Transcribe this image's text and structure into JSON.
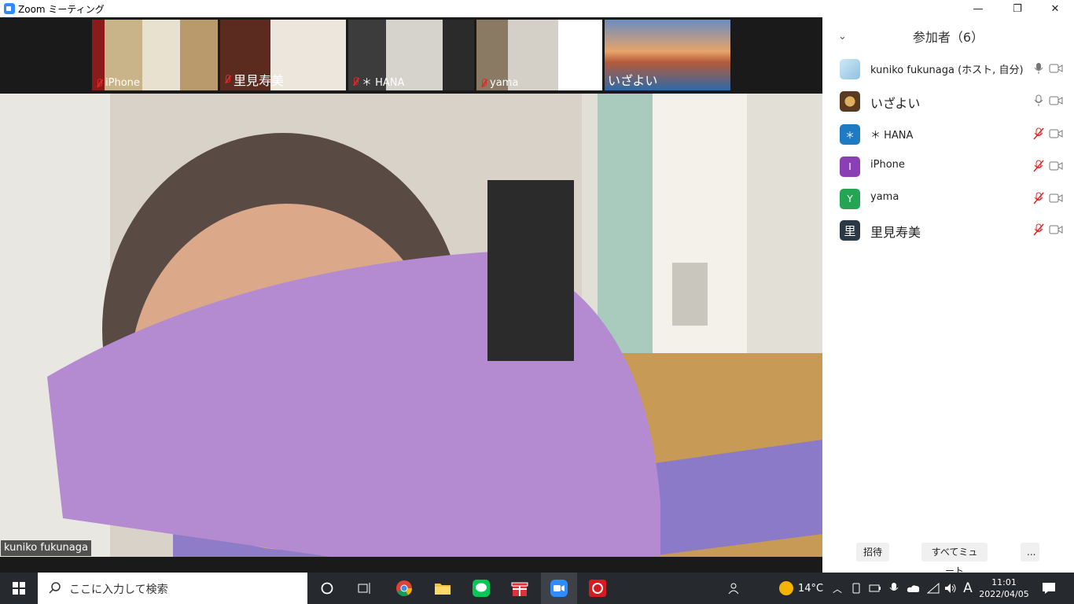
{
  "window": {
    "title": "Zoom ミーティング",
    "minimize": "—",
    "maximize": "❐",
    "close": "✕"
  },
  "thumbnails": [
    {
      "name": "iPhone",
      "muted": true
    },
    {
      "name": "里見寿美",
      "muted": true
    },
    {
      "name": "＊ HANA",
      "muted": true
    },
    {
      "name": "yama",
      "muted": true
    },
    {
      "name": "いざよい",
      "muted": false
    }
  ],
  "main_video": {
    "speaker_name": "kuniko fukunaga"
  },
  "panel": {
    "title": "参加者（6）",
    "participants": [
      {
        "name": "kuniko fukunaga (ホスト, 自分)",
        "avatar": "",
        "avatar_color": "#9ec9e8",
        "muted": false
      },
      {
        "name": "いざよい",
        "avatar": "",
        "avatar_color": "#7a5a3a",
        "muted": false
      },
      {
        "name": "＊ HANA",
        "avatar": "＊",
        "avatar_color": "#1f7ac4",
        "muted": true
      },
      {
        "name": "iPhone",
        "avatar": "I",
        "avatar_color": "#8b3fb4",
        "muted": true
      },
      {
        "name": "yama",
        "avatar": "Y",
        "avatar_color": "#23a554",
        "muted": true
      },
      {
        "name": "里見寿美",
        "avatar": "里",
        "avatar_color": "#2b3846",
        "muted": true
      }
    ],
    "invite_label": "招待",
    "mute_all_label": "すべてミュート",
    "more_label": "..."
  },
  "taskbar": {
    "search_placeholder": "ここに入力して検索",
    "weather": "14°C",
    "ime": "A",
    "time": "11:01",
    "date": "2022/04/05"
  },
  "colors": {
    "accent": "#2d8cff",
    "muted_red": "#e02828",
    "taskbar": "#26292d"
  }
}
